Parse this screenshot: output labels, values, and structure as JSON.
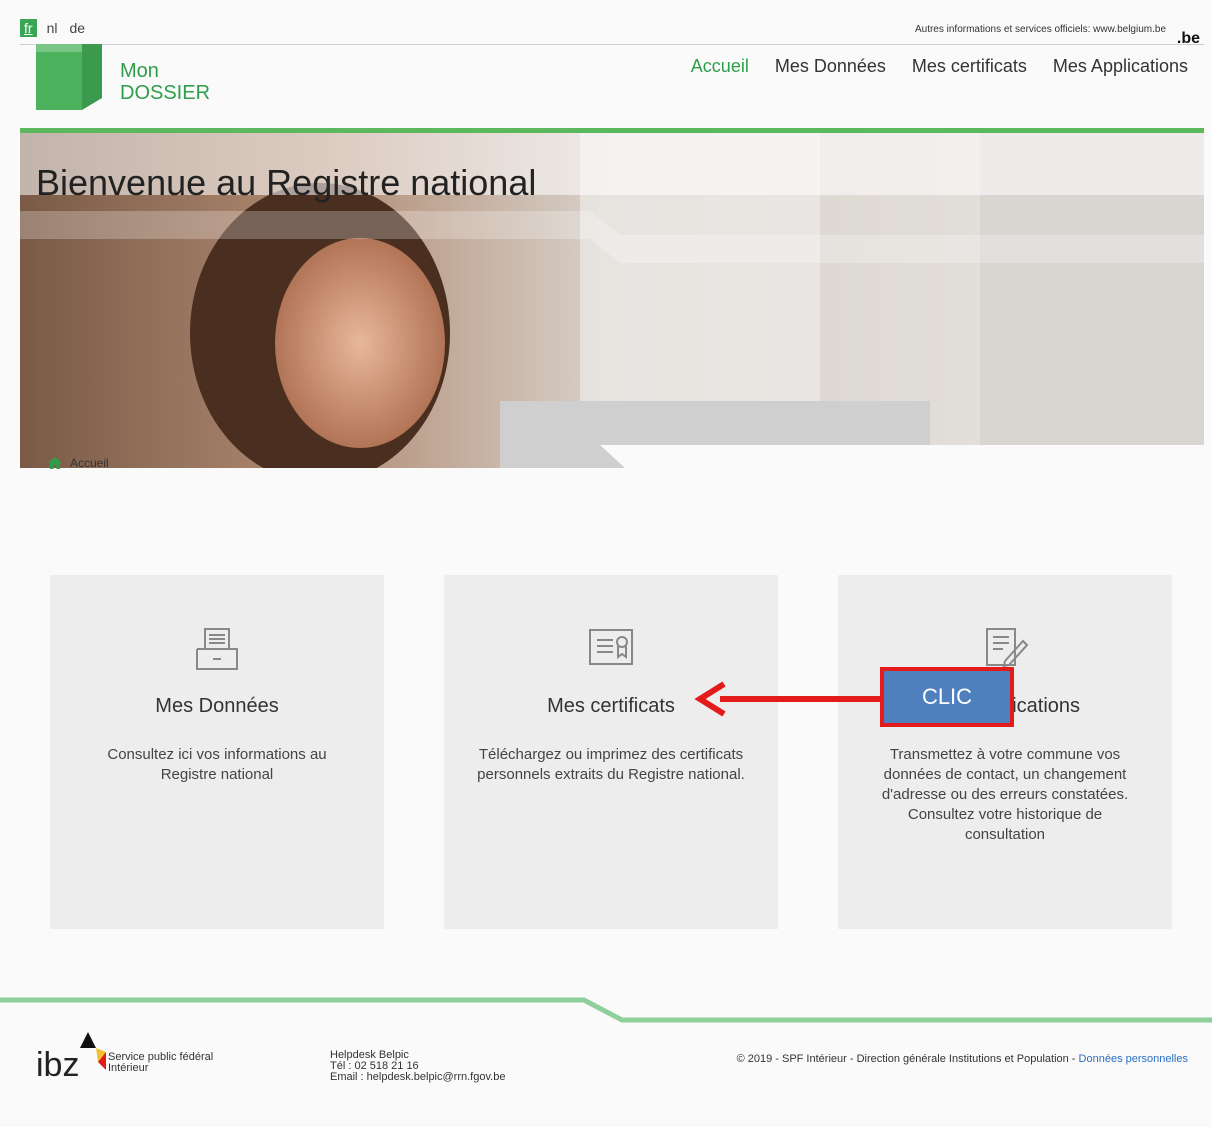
{
  "languages": [
    {
      "label": "fr",
      "active": true
    },
    {
      "label": "nl",
      "active": false
    },
    {
      "label": "de",
      "active": false
    }
  ],
  "top_info": "Autres informations et services officiels: www.belgium.be",
  "be_logo": ".be",
  "logo": {
    "line1": "Mon",
    "line2": "DOSSIER"
  },
  "nav": [
    "Accueil",
    "Mes Données",
    "Mes certificats",
    "Mes Applications"
  ],
  "hero_title": "Bienvenue au Registre national",
  "breadcrumb": "Accueil",
  "cards": [
    {
      "title": "Mes Données",
      "desc": "Consultez ici vos informations au Registre national",
      "icon": "drawer-icon"
    },
    {
      "title": "Mes certificats",
      "desc": "Téléchargez ou imprimez des certificats personnels extraits du Registre national.",
      "icon": "certificate-icon"
    },
    {
      "title": "Mes Applications",
      "desc": "Transmettez à votre commune vos données de contact, un changement d'adresse ou des erreurs constatées. Consultez votre historique de consultation",
      "icon": "edit-document-icon"
    }
  ],
  "annotation": {
    "label": "CLIC"
  },
  "footer": {
    "ibz_logo_text": "ibz",
    "ibz_line1": "Service public fédéral",
    "ibz_line2": "Intérieur",
    "helpdesk_line1": "Helpdesk Belpic",
    "helpdesk_line2": "Tél : 02 518 21 16",
    "helpdesk_line3": "Email : helpdesk.belpic@rrn.fgov.be",
    "copyright": "© 2019 - SPF Intérieur - Direction générale Institutions et Population - ",
    "privacy_link": "Données personnelles"
  },
  "colors": {
    "brand_green": "#2f9e4a",
    "annotation_red": "#e41b1b",
    "annotation_blue": "#4f80bd",
    "link_blue": "#2a6fc0"
  }
}
